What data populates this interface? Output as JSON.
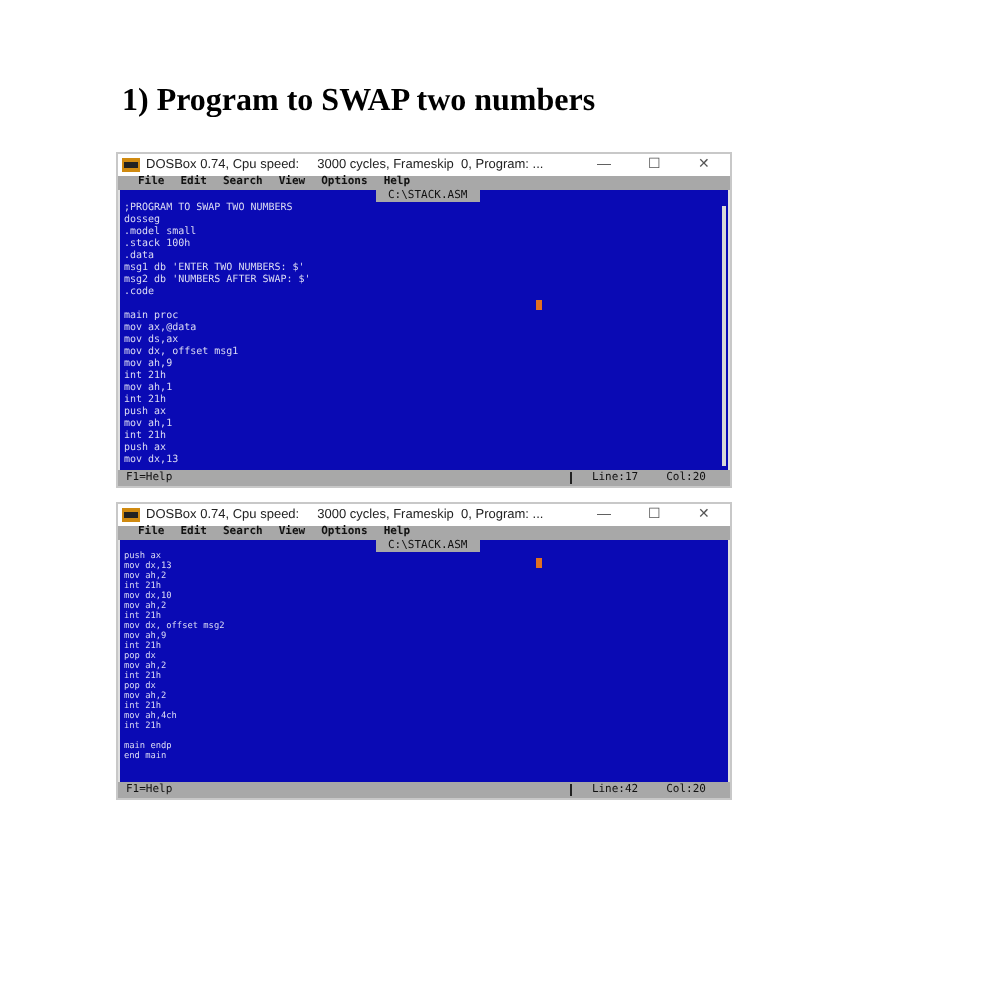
{
  "heading": "1) Program to SWAP two numbers",
  "windows": [
    {
      "title": "DOSBox 0.74, Cpu speed:     3000 cycles, Frameskip  0, Program: ...",
      "controls": [
        "—",
        "☐",
        "✕"
      ],
      "menu": [
        "File",
        "Edit",
        "Search",
        "View",
        "Options",
        "Help"
      ],
      "file_tab": "C:\\STACK.ASM",
      "code_blocks": [
        [
          ";PROGRAM TO SWAP TWO NUMBERS",
          "dosseg",
          ".model small",
          ".stack 100h",
          ".data",
          "msg1 db 'ENTER TWO NUMBERS: $'",
          "msg2 db 'NUMBERS AFTER SWAP: $'",
          ".code"
        ],
        [
          "main proc",
          "mov ax,@data",
          "mov ds,ax",
          "mov dx, offset msg1",
          "mov ah,9",
          "int 21h",
          "mov ah,1",
          "int 21h",
          "push ax",
          "mov ah,1",
          "int 21h",
          "push ax",
          "mov dx,13"
        ]
      ],
      "scrollbar": true,
      "status": {
        "help": "F1=Help",
        "line": "Line:17",
        "col": "Col:20"
      }
    },
    {
      "title": "DOSBox 0.74, Cpu speed:     3000 cycles, Frameskip  0, Program: ...",
      "controls": [
        "—",
        "☐",
        "✕"
      ],
      "menu": [
        "File",
        "Edit",
        "Search",
        "View",
        "Options",
        "Help"
      ],
      "file_tab": "C:\\STACK.ASM",
      "code_blocks": [
        [
          "push ax",
          "mov dx,13",
          "mov ah,2",
          "int 21h",
          "mov dx,10",
          "mov ah,2",
          "int 21h",
          "mov dx, offset msg2",
          "mov ah,9",
          "int 21h",
          "pop dx",
          "mov ah,2",
          "int 21h",
          "pop dx",
          "mov ah,2",
          "int 21h",
          "mov ah,4ch",
          "int 21h"
        ],
        [
          "main endp",
          "end main"
        ]
      ],
      "scrollbar": false,
      "status": {
        "help": "F1=Help",
        "line": "Line:42",
        "col": "Col:20"
      }
    }
  ]
}
